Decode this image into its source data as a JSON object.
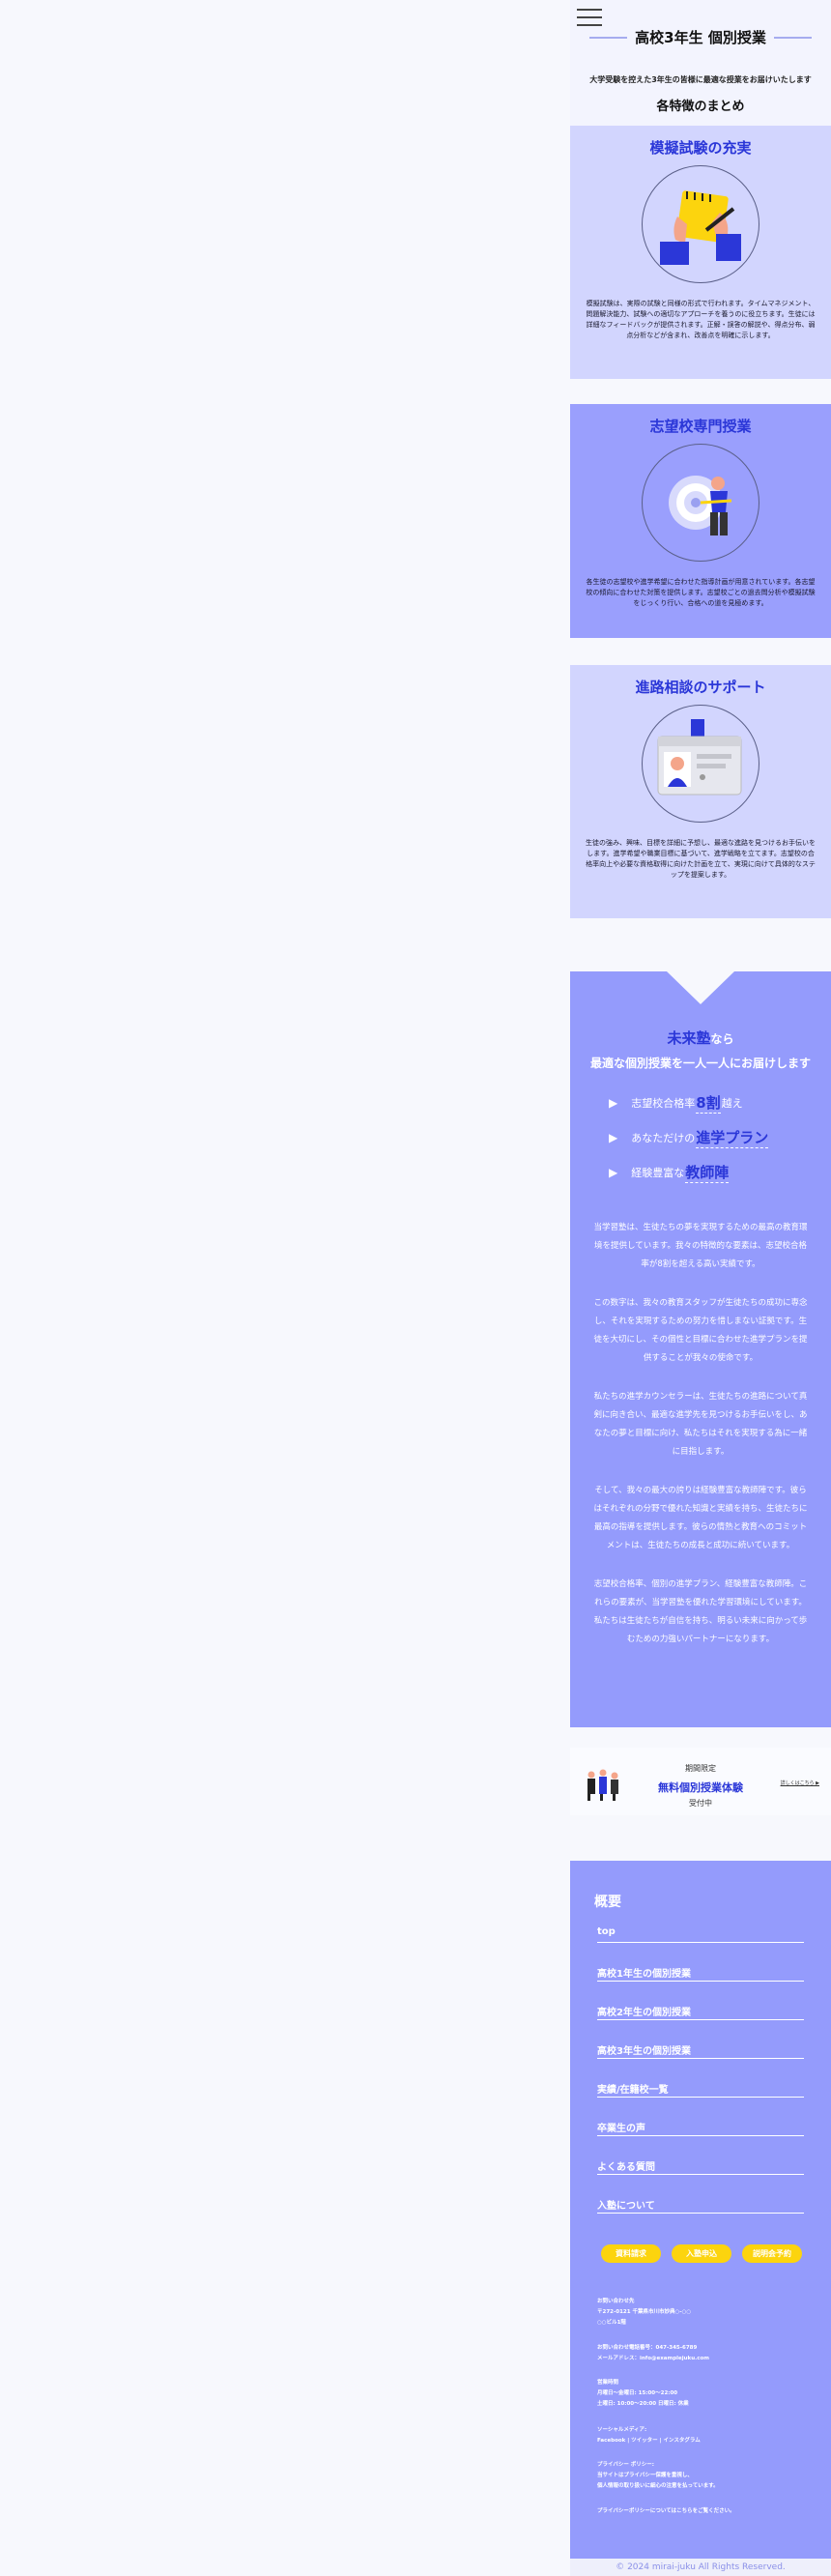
{
  "header": {
    "title": "高校3年生 個別授業",
    "lead": "大学受験を控えた3年生の皆様に最適な授業をお届けいたします",
    "summary": "各特徴のまとめ"
  },
  "features": [
    {
      "title": "模擬試験の充実",
      "text": "模擬試験は、実際の試験と同様の形式で行われます。タイムマネジメント、問題解決能力、試験への適切なアプローチを養うのに役立ちます。生徒には詳細なフィードバックが提供されます。正解・誤答の解説や、得点分布、弱点分析などが含まれ、改善点を明確に示します。"
    },
    {
      "title": "志望校専門授業",
      "text": "各生徒の志望校や進学希望に合わせた指導計画が用意されています。各志望校の傾向に合わせた対策を提供します。志望校ごとの過去問分析や模擬試験をじっくり行い、合格への道を見極めます。"
    },
    {
      "title": "進路相談のサポート",
      "text": "生徒の強み、興味、目標を詳細に予想し、最適な進路を見つけるお手伝いをします。進学希望や職業目標に基づいて、進学戦略を立てます。志望校の合格率向上や必要な資格取得に向けた計画を立て、実現に向けて具体的なステップを提案します。"
    }
  ],
  "promo": {
    "brand": "未来塾",
    "brand_suffix": "なら",
    "headline": "最適な個別授業を一人一人にお届けします",
    "points": [
      {
        "pre": "志望校合格率",
        "em": "8割",
        "post": "越え"
      },
      {
        "pre": "あなただけの",
        "em": "進学プラン",
        "post": ""
      },
      {
        "pre": "経験豊富な",
        "em": "教師陣",
        "post": ""
      }
    ],
    "paragraphs": [
      "当学習塾は、生徒たちの夢を実現するための最高の教育環境を提供しています。我々の特徴的な要素は、志望校合格率が8割を超える高い実績です。",
      "この数字は、我々の教育スタッフが生徒たちの成功に専念し、それを実現するための努力を惜しまない証拠です。生徒を大切にし、その個性と目標に合わせた進学プランを提供することが我々の使命です。",
      "私たちの進学カウンセラーは、生徒たちの進路について真剣に向き合い、最適な進学先を見つけるお手伝いをし、あなたの夢と目標に向け、私たちはそれを実現する為に一緒に目指します。",
      "そして、我々の最大の誇りは経験豊富な教師陣です。彼らはそれぞれの分野で優れた知識と実績を持ち、生徒たちに最高の指導を提供します。彼らの情熱と教育へのコミットメントは、生徒たちの成長と成功に続いています。",
      "志望校合格率、個別の進学プラン、経験豊富な教師陣。これらの要素が、当学習塾を優れた学習環境にしています。私たちは生徒たちが自信を持ち、明るい未来に向かって歩むための力強いパートナーになります。"
    ]
  },
  "cta": {
    "line1": "期間限定",
    "line2": "無料個別授業体験",
    "line3": "受付中",
    "more": "詳しくはこちら ▶"
  },
  "footer": {
    "heading": "概要",
    "links": [
      "top",
      "高校1年生の個別授業",
      "高校2年生の個別授業",
      "高校3年生の個別授業",
      "実績/在籍校一覧",
      "卒業生の声",
      "よくある質問",
      "入塾について"
    ],
    "buttons": [
      "資料請求",
      "入塾申込",
      "説明会予約"
    ],
    "address": [
      "お問い合わせ先",
      "〒272-0121 千葉県市川市妙典○-○○",
      "○○ビル1階"
    ],
    "contact": [
      "お問い合わせ電話番号：047-345-6789",
      "メールアドレス：info@examplejuku.com"
    ],
    "hours": [
      "営業時間",
      "月曜日〜金曜日: 15:00〜22:00",
      "土曜日: 10:00〜20:00 日曜日: 休業"
    ],
    "social": [
      "ソーシャルメディア:",
      "Facebook | ツイッター | インスタグラム"
    ],
    "privacy": [
      "プライバシー ポリシー:",
      "当サイトはプライバシー保護を重視し、",
      "個人情報の取り扱いに細心の注意を払っています。"
    ],
    "privacy_link": "プライバシーポリシーについてはこちらをご覧ください。",
    "copyright": "© 2024 mirai-juku All Rights Reserved."
  },
  "colors": {
    "accent": "#2b37d8",
    "light_panel": "#d2d5fe",
    "mid_panel": "#949bfc",
    "button": "#fcd40e"
  }
}
